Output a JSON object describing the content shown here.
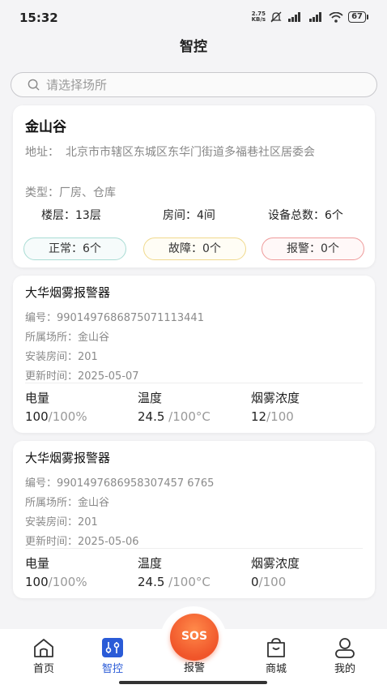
{
  "status": {
    "time": "15:32",
    "net_speed_top": "2.75",
    "net_speed_bottom": "KB/s",
    "battery": "67"
  },
  "header": {
    "title": "智控"
  },
  "search": {
    "placeholder": "请选择场所"
  },
  "place": {
    "name": "金山谷",
    "address_label": "地址：",
    "address": "北京市市辖区东城区东华门街道多福巷社区居委会",
    "type": "类型：厂房、仓库",
    "floors": "楼层：13层",
    "rooms": "房间：4间",
    "devices": "设备总数：6个",
    "normal": "正常：6个",
    "fault": "故障：0个",
    "alarm": "报警：0个"
  },
  "devices": [
    {
      "name": "大华烟雾报警器",
      "code": "编号：9901497686875071113441",
      "place": "所属场所：金山谷",
      "room": "安装房间：201",
      "updated": "更新时间：2025-05-07",
      "battery_label": "电量",
      "battery_value": "100",
      "battery_max": "/100%",
      "temp_label": "温度",
      "temp_value": "24.5",
      "temp_max": " /100°C",
      "smoke_label": "烟雾浓度",
      "smoke_value": "12",
      "smoke_max": "/100"
    },
    {
      "name": "大华烟雾报警器",
      "code": "编号：9901497686958307457 6765",
      "place": "所属场所：金山谷",
      "room": "安装房间：201",
      "updated": "更新时间：2025-05-06",
      "battery_label": "电量",
      "battery_value": "100",
      "battery_max": "/100%",
      "temp_label": "温度",
      "temp_value": "24.5",
      "temp_max": " /100°C",
      "smoke_label": "烟雾浓度",
      "smoke_value": "0",
      "smoke_max": "/100"
    }
  ],
  "tabs": {
    "home": "首页",
    "control": "智控",
    "sos": "SOS",
    "alarm": "报警",
    "mall": "商城",
    "mine": "我的"
  },
  "colors": {
    "accent": "#2a5bd7",
    "sos": "#f0552a"
  }
}
